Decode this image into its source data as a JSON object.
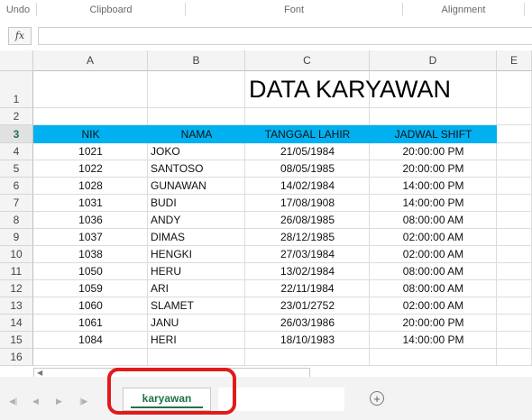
{
  "ribbon": {
    "undo": "Undo",
    "clipboard": "Clipboard",
    "font": "Font",
    "alignment": "Alignment"
  },
  "formula_bar": {
    "fx_label": "fx",
    "value": ""
  },
  "columns": [
    "A",
    "B",
    "C",
    "D",
    "E"
  ],
  "row_numbers": [
    "1",
    "2",
    "3",
    "4",
    "5",
    "6",
    "7",
    "8",
    "9",
    "10",
    "11",
    "12",
    "13",
    "14",
    "15",
    "16"
  ],
  "title": "DATA KARYAWAN",
  "table": {
    "headers": [
      "NIK",
      "NAMA",
      "TANGGAL LAHIR",
      "JADWAL SHIFT"
    ],
    "header_color": "#00b0f0",
    "rows": [
      [
        "1021",
        "JOKO",
        "21/05/1984",
        "20:00:00 PM"
      ],
      [
        "1022",
        "SANTOSO",
        "08/05/1985",
        "20:00:00 PM"
      ],
      [
        "1028",
        "GUNAWAN",
        "14/02/1984",
        "14:00:00 PM"
      ],
      [
        "1031",
        "BUDI",
        "17/08/1908",
        "14:00:00 PM"
      ],
      [
        "1036",
        "ANDY",
        "26/08/1985",
        "08:00:00 AM"
      ],
      [
        "1037",
        "DIMAS",
        "28/12/1985",
        "02:00:00 AM"
      ],
      [
        "1038",
        "HENGKI",
        "27/03/1984",
        "02:00:00 AM"
      ],
      [
        "1050",
        "HERU",
        "13/02/1984",
        "08:00:00 AM"
      ],
      [
        "1059",
        "ARI",
        "22/11/1984",
        "08:00:00 AM"
      ],
      [
        "1060",
        "SLAMET",
        "23/01/2752",
        "02:00:00 AM"
      ],
      [
        "1061",
        "JANU",
        "26/03/1986",
        "20:00:00 PM"
      ],
      [
        "1084",
        "HERI",
        "18/10/1983",
        "14:00:00 PM"
      ]
    ]
  },
  "sheet_tab": {
    "label": "karyawan",
    "color": "#217346"
  },
  "add_sheet": "+",
  "highlight_color": "#e21a1a"
}
